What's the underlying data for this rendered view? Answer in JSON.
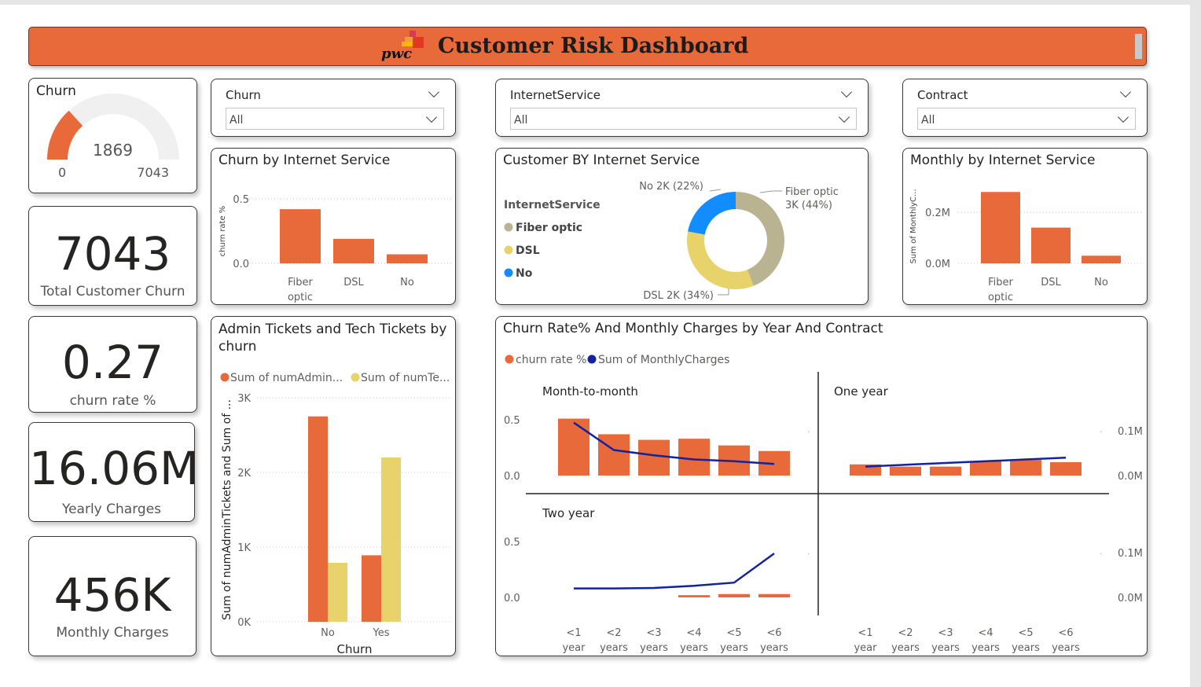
{
  "header": {
    "logo_text": "pwc",
    "title": "Customer Risk Dashboard",
    "color": "#E8693A"
  },
  "accent": {
    "orange": "#E8693A",
    "yellow": "#E8D36A",
    "navy": "#12239E",
    "blue": "#118DFF",
    "taupe": "#B9B391"
  },
  "gauge": {
    "title": "Churn",
    "value": "1869",
    "min": "0",
    "max": "7043",
    "value_num": 1869,
    "max_num": 7043
  },
  "kpis": {
    "total": {
      "value": "7043",
      "label": "Total Customer Churn"
    },
    "rate": {
      "value": "0.27",
      "label": "churn rate %"
    },
    "yearly": {
      "value": "16.06M",
      "label": "Yearly Charges"
    },
    "monthly": {
      "value": "456K",
      "label": "Monthly Charges"
    }
  },
  "slicers": [
    {
      "title": "Churn",
      "value": "All"
    },
    {
      "title": "InternetService",
      "value": "All"
    },
    {
      "title": "Contract",
      "value": "All"
    }
  ],
  "chart_data": [
    {
      "id": "churn_by_internet",
      "type": "bar",
      "title": "Churn by Internet Service",
      "ylabel": "churn rate %",
      "categories": [
        "Fiber optic",
        "DSL",
        "No"
      ],
      "values": [
        0.42,
        0.19,
        0.07
      ],
      "ylim": [
        0,
        0.5
      ],
      "yticks": [
        {
          "v": 0,
          "label": "0.0"
        },
        {
          "v": 0.5,
          "label": "0.5"
        }
      ]
    },
    {
      "id": "customer_by_internet",
      "type": "pie",
      "title": "Customer BY Internet Service",
      "legend_title": "InternetService",
      "slices": [
        {
          "name": "Fiber optic",
          "value": 44,
          "label": "Fiber optic",
          "label2": "3K (44%)",
          "color": "#B9B391"
        },
        {
          "name": "DSL",
          "value": 34,
          "label": "DSL 2K (34%)",
          "color": "#E8D36A"
        },
        {
          "name": "No",
          "value": 22,
          "label": "No 2K (22%)",
          "color": "#118DFF"
        }
      ]
    },
    {
      "id": "monthly_by_internet",
      "type": "bar",
      "title": "Monthly by Internet Service",
      "ylabel": "Sum of MonthlyC...",
      "categories": [
        "Fiber optic",
        "DSL",
        "No"
      ],
      "values": [
        0.28,
        0.14,
        0.03
      ],
      "ylim": [
        0,
        0.29
      ],
      "yticks": [
        {
          "v": 0,
          "label": "0.0M"
        },
        {
          "v": 0.2,
          "label": "0.2M"
        }
      ]
    },
    {
      "id": "tickets_by_churn",
      "type": "bar",
      "title": "Admin Tickets and Tech Tickets by churn",
      "xlabel": "Churn",
      "ylabel": "Sum of numAdminTickets and Sum of ...",
      "legend": [
        "Sum of numAdmin...",
        "Sum of numTe..."
      ],
      "categories": [
        "No",
        "Yes"
      ],
      "series": [
        {
          "name": "Sum of numAdmin...",
          "values": [
            2750,
            890
          ],
          "color": "#E8693A"
        },
        {
          "name": "Sum of numTe...",
          "values": [
            790,
            2200
          ],
          "color": "#E8D36A"
        }
      ],
      "ylim": [
        0,
        3000
      ],
      "yticks": [
        {
          "v": 0,
          "label": "0K"
        },
        {
          "v": 1000,
          "label": "1K"
        },
        {
          "v": 2000,
          "label": "2K"
        },
        {
          "v": 3000,
          "label": "3K"
        }
      ]
    },
    {
      "id": "churn_rate_monthly_by_year_contract",
      "type": "bar",
      "title": "Churn Rate% And Monthly Charges by Year And Contract",
      "legend": [
        "churn rate %",
        "Sum of MonthlyCharges"
      ],
      "categories": [
        "<1 year",
        "<2 years",
        "<3 years",
        "<4 years",
        "<5 years",
        "<6 years"
      ],
      "y_left_ticks": [
        {
          "v": 0,
          "label": "0.0"
        },
        {
          "v": 0.5,
          "label": "0.5"
        }
      ],
      "y_right_ticks": [
        {
          "v": 0,
          "label": "0.0M"
        },
        {
          "v": 0.1,
          "label": "0.1M"
        }
      ],
      "panels": [
        {
          "name": "Month-to-month",
          "churn_rate": [
            0.51,
            0.37,
            0.32,
            0.33,
            0.27,
            0.22
          ],
          "monthly_charges": [
            0.118,
            0.057,
            0.045,
            0.036,
            0.032,
            0.026
          ]
        },
        {
          "name": "One year",
          "churn_rate": [
            0.1,
            0.08,
            0.08,
            0.13,
            0.14,
            0.12
          ],
          "monthly_charges": [
            0.02,
            0.024,
            0.028,
            0.032,
            0.036,
            0.04
          ]
        },
        {
          "name": "Two year",
          "churn_rate": [
            0.0,
            0.0,
            0.0,
            0.02,
            0.03,
            0.03
          ],
          "monthly_charges": [
            0.02,
            0.02,
            0.021,
            0.026,
            0.033,
            0.098
          ]
        }
      ]
    }
  ]
}
